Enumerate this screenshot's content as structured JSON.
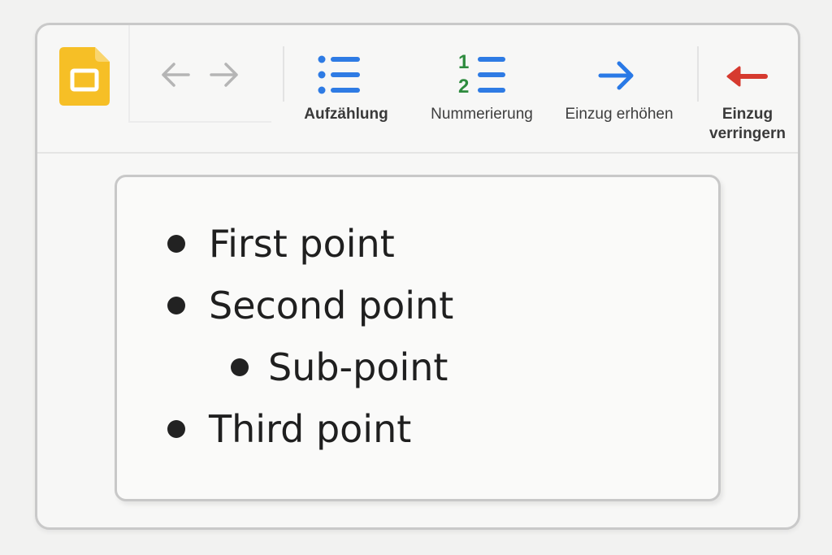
{
  "toolbar": {
    "app_icon": "google-slides-logo",
    "back_icon": "arrow-left-icon",
    "forward_icon": "arrow-right-icon",
    "bulleted_list": {
      "label": "Aufzählung",
      "icon": "bulleted-list-icon"
    },
    "numbered_list": {
      "label": "Nummerierung",
      "icon": "numbered-list-icon",
      "numbers": [
        "1",
        "2"
      ]
    },
    "increase_indent": {
      "label": "Einzug erhöhen",
      "icon": "arrow-right-icon"
    },
    "decrease_indent": {
      "label": "Einzug verringern",
      "icon": "arrow-left-icon"
    }
  },
  "colors": {
    "logo_yellow": "#F6BF26",
    "list_blue": "#2E7BE4",
    "number_green": "#2E8B3E",
    "indent_blue": "#2979E6",
    "outdent_red": "#D63A2F",
    "nav_gray": "#B5B5B5"
  },
  "slide": {
    "bullets": [
      {
        "text": "First point",
        "level": 0
      },
      {
        "text": "Second point",
        "level": 0
      },
      {
        "text": "Sub-point",
        "level": 1
      },
      {
        "text": "Third point",
        "level": 0
      }
    ]
  }
}
